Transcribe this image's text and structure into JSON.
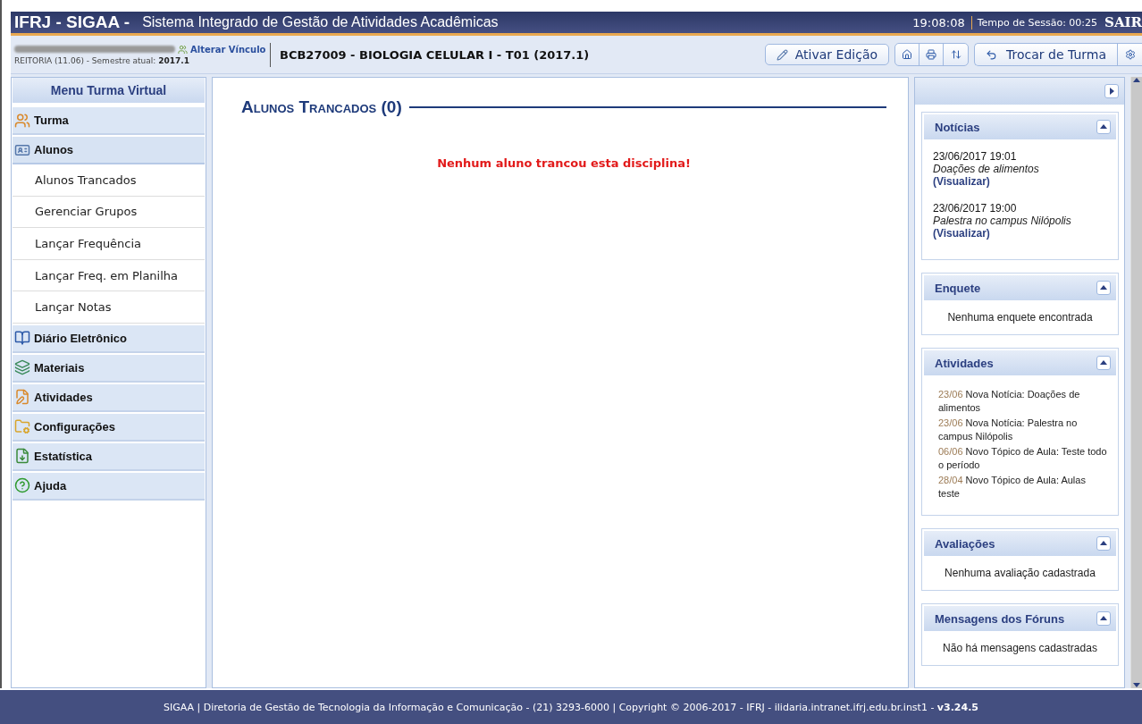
{
  "header": {
    "title": "IFRJ - SIGAA -",
    "subtitle": "Sistema Integrado de Gestão de Atividades Acadêmicas",
    "clock": "19:08:08",
    "session": "Tempo de Sessão: 00:25",
    "logout": "SAIR"
  },
  "user": {
    "change_link": "Alterar Vínculo",
    "unit": "REITORIA (11.06) - Semestre atual: **2017.1**"
  },
  "course_title": "BCB27009 - BIOLOGIA CELULAR I - T01 (2017.1)",
  "toolbar": {
    "edit_button": "Ativar Edição",
    "switch_button": "Trocar de Turma"
  },
  "menu": {
    "title": "Menu Turma Virtual",
    "sections": [
      {
        "label": "Turma",
        "expanded": false
      },
      {
        "label": "Alunos",
        "expanded": true,
        "children": [
          {
            "label": "Alunos Trancados"
          },
          {
            "label": "Gerenciar Grupos"
          },
          {
            "label": "Lançar Frequência"
          },
          {
            "label": "Lançar Freq. em Planilha"
          },
          {
            "label": "Lançar Notas"
          }
        ]
      },
      {
        "label": "Diário Eletrônico",
        "expanded": false
      },
      {
        "label": "Materiais",
        "expanded": false
      },
      {
        "label": "Atividades",
        "expanded": false
      },
      {
        "label": "Configurações",
        "expanded": false
      },
      {
        "label": "Estatística",
        "expanded": false
      },
      {
        "label": "Ajuda",
        "expanded": false
      }
    ]
  },
  "content": {
    "heading": "Alunos Trancados (0)",
    "message": "Nenhum aluno trancou esta disciplina!"
  },
  "panels": [
    {
      "kind": "news",
      "title": "Notícias",
      "items": [
        {
          "date": "23/06/2017 19:01",
          "title": "Doações de alimentos",
          "link": "(Visualizar)"
        },
        {
          "date": "23/06/2017 19:00",
          "title": "Palestra no campus Nilópolis",
          "link": "(Visualizar)"
        }
      ]
    },
    {
      "kind": "message",
      "title": "Enquete",
      "text": "Nenhuma enquete encontrada"
    },
    {
      "kind": "activities",
      "title": "Atividades",
      "items": [
        {
          "date": "23/06",
          "text": "Nova Notícia: Doações de alimentos"
        },
        {
          "date": "23/06",
          "text": "Nova Notícia: Palestra no campus Nilópolis"
        },
        {
          "date": "06/06",
          "text": "Novo Tópico de Aula: Teste todo o período"
        },
        {
          "date": "28/04",
          "text": "Novo Tópico de Aula: Aulas teste"
        }
      ]
    },
    {
      "kind": "message",
      "title": "Avaliações",
      "text": "Nenhuma avaliação cadastrada"
    },
    {
      "kind": "message",
      "title": "Mensagens dos Fóruns",
      "text": "Não há mensagens cadastradas"
    }
  ],
  "footer": "SIGAA | Diretoria de Gestão de Tecnologia da Informação e Comunicação - (21) 3293-6000 | Copyright © 2006-2017 - IFRJ - ilidaria.intranet.ifrj.edu.br.inst1 - **v3.24.5**"
}
